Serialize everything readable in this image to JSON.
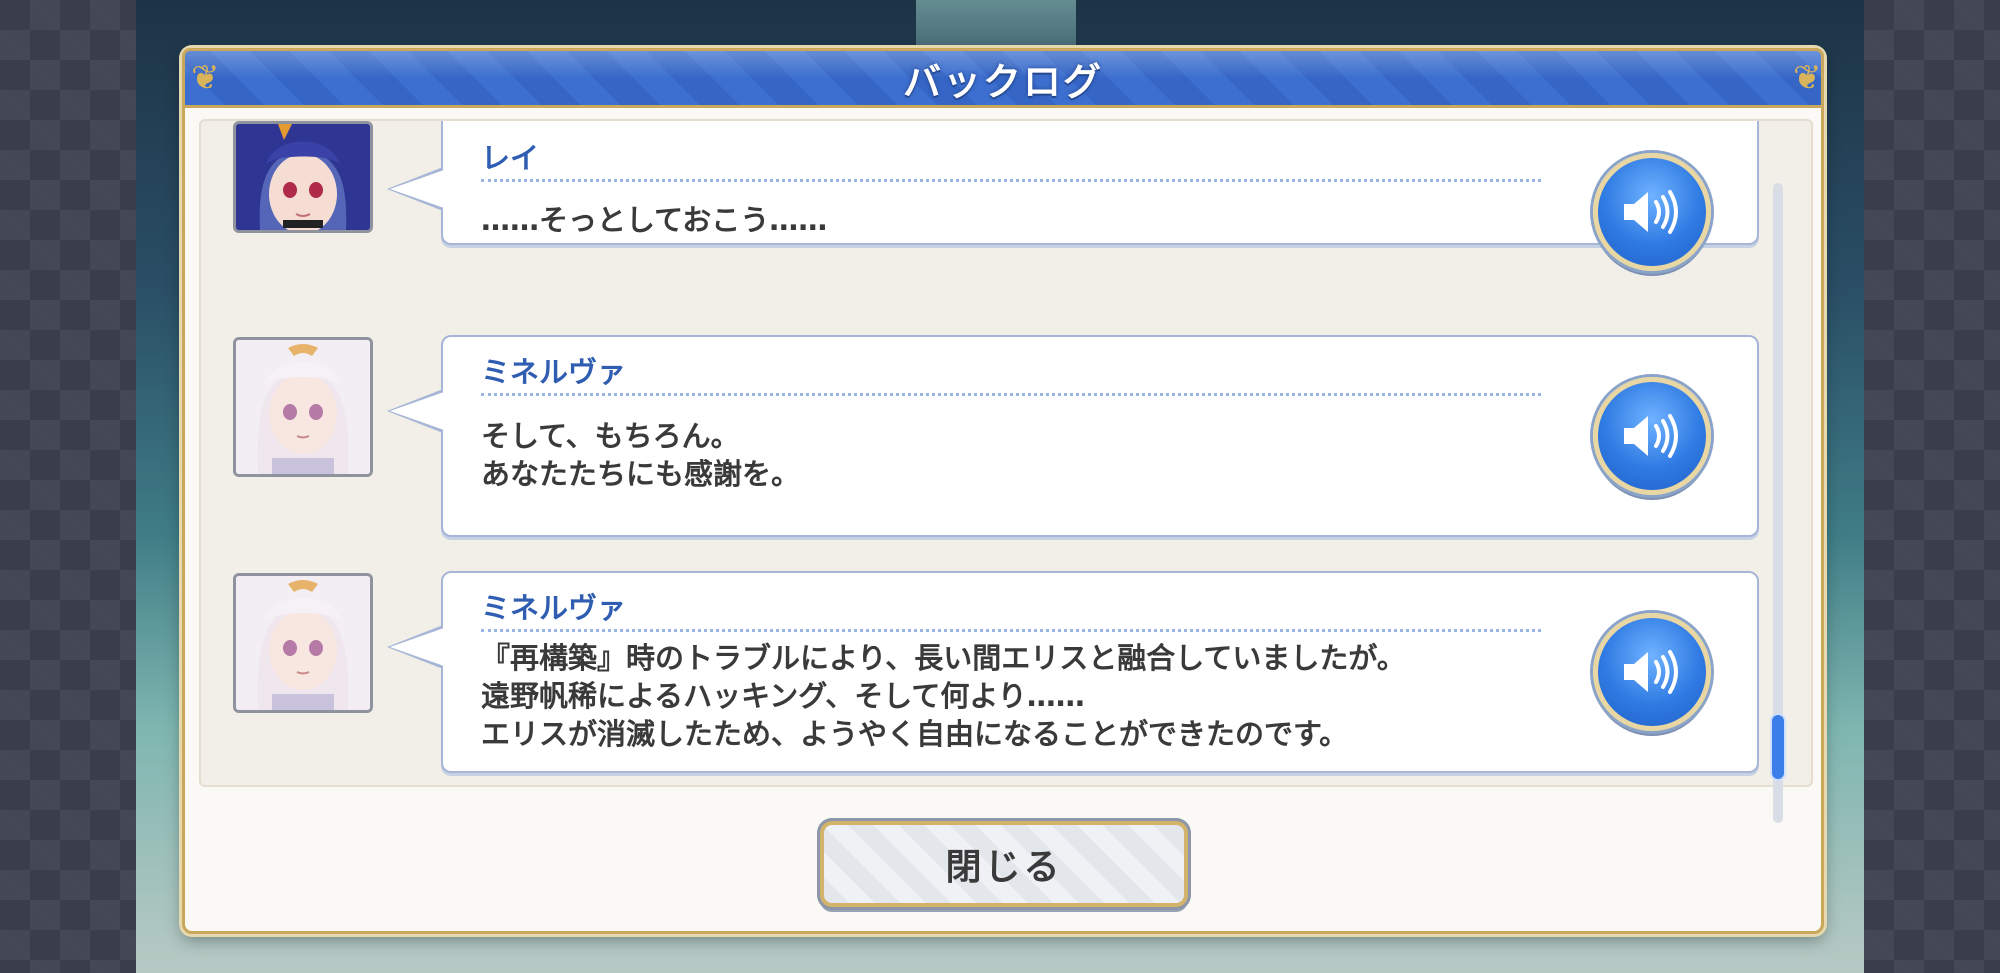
{
  "window": {
    "title": "バックログ"
  },
  "entries": [
    {
      "speaker": "レイ",
      "text": "……そっとしておこう……",
      "portrait": "purple-hair-girl-portrait"
    },
    {
      "speaker": "ミネルヴァ",
      "text": "そして、もちろん。\nあなたたちにも感謝を。",
      "portrait": "white-hair-girl-portrait"
    },
    {
      "speaker": "ミネルヴァ",
      "text": "『再構築』時のトラブルにより、長い間エリスと融合していましたが。\n遠野帆稀によるハッキング、そして何より……\nエリスが消滅したため、ようやく自由になることができたのです。",
      "portrait": "white-hair-girl-portrait"
    }
  ],
  "close_button": {
    "label": "閉じる"
  },
  "colors": {
    "title_bar": "#3a6cd0",
    "speaker_name": "#2f5db1",
    "voice_button": "#2f7be3",
    "frame_gold": "#c9a85b"
  }
}
